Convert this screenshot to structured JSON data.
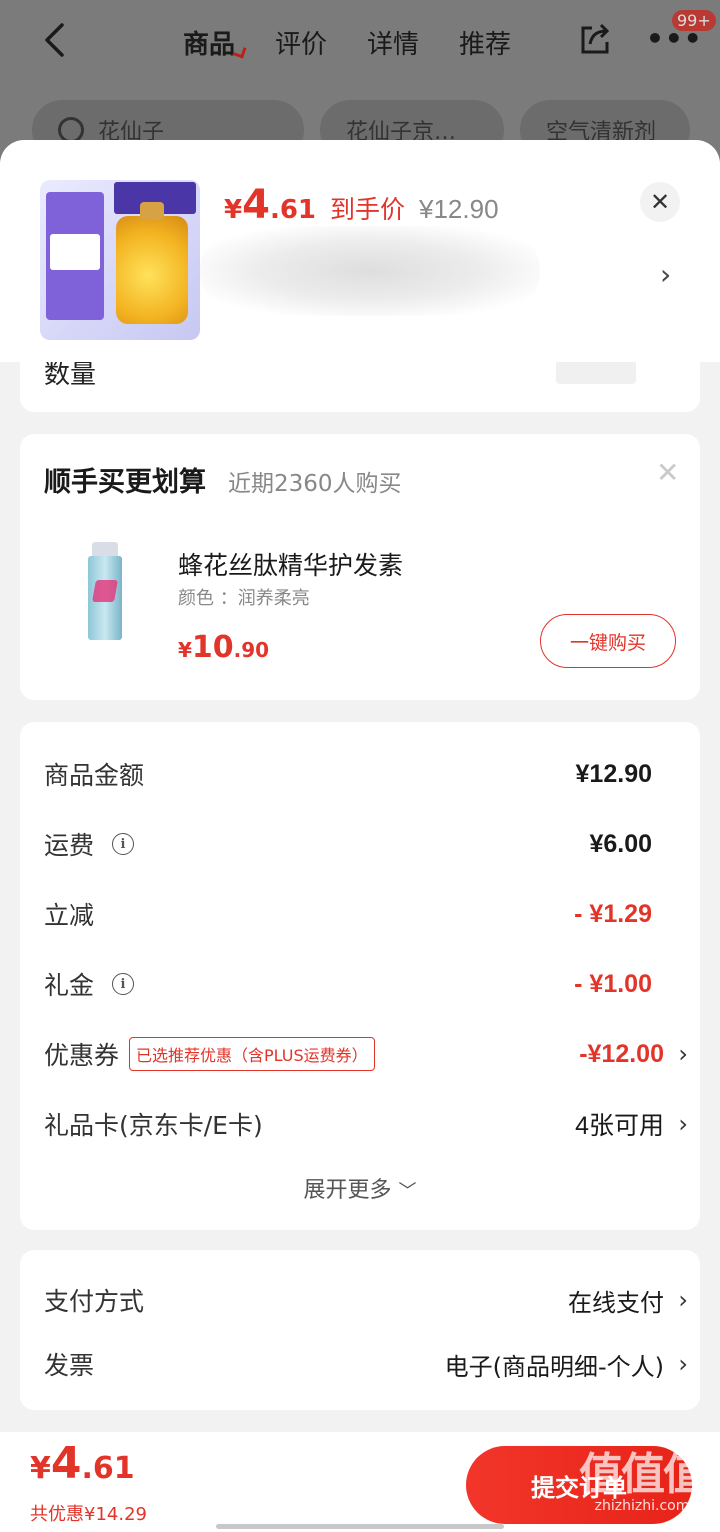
{
  "nav": {
    "tabs": [
      "商品",
      "评价",
      "详情",
      "推荐"
    ],
    "badge": "99+"
  },
  "chips": [
    "花仙子",
    "花仙子京…",
    "空气清新剂"
  ],
  "header": {
    "price_currency": "¥",
    "price_int": "4",
    "price_dec": ".61",
    "price_label": "到手价",
    "original_price": "¥12.90"
  },
  "qty": {
    "label": "数量"
  },
  "bundle": {
    "title": "顺手买更划算",
    "subtitle": "近期2360人购买",
    "product_name": "蜂花丝肽精华护发素",
    "spec": "颜色 ：润养柔亮",
    "price_currency": "¥",
    "price_int": "10",
    "price_dec": ".90",
    "buy_label": "一键购买"
  },
  "fees": {
    "rows": [
      {
        "label": "商品金额",
        "value": "¥12.90"
      },
      {
        "label": "运费",
        "value": "¥6.00"
      },
      {
        "label": "立减",
        "value": "- ¥1.29"
      },
      {
        "label": "礼金",
        "value": "- ¥1.00"
      },
      {
        "label": "优惠券",
        "tag": "已选推荐优惠（含PLUS运费券）",
        "value": "-¥12.00"
      },
      {
        "label": "礼品卡(京东卡/E卡)",
        "value": "4张可用"
      }
    ],
    "expand_label": "展开更多"
  },
  "payment": {
    "method_label": "支付方式",
    "method_value": "在线支付",
    "invoice_label": "发票",
    "invoice_value": "电子(商品明细-个人)"
  },
  "footer": {
    "total_currency": "¥",
    "total_int": "4",
    "total_dec": ".61",
    "saved_text": "共优惠¥14.29",
    "submit_label": "提交订单",
    "watermark_big": "值值值",
    "watermark_small": "zhizhizhi.com"
  },
  "colors": {
    "accent": "#e3342a",
    "overlay": "#7b7b7b",
    "sheet_bg": "#f2f2f2"
  },
  "icons": [
    "back-arrow-icon",
    "share-icon",
    "more-dots-icon",
    "search-icon",
    "close-icon",
    "chevron-right-icon",
    "info-icon",
    "chevron-down-icon"
  ]
}
